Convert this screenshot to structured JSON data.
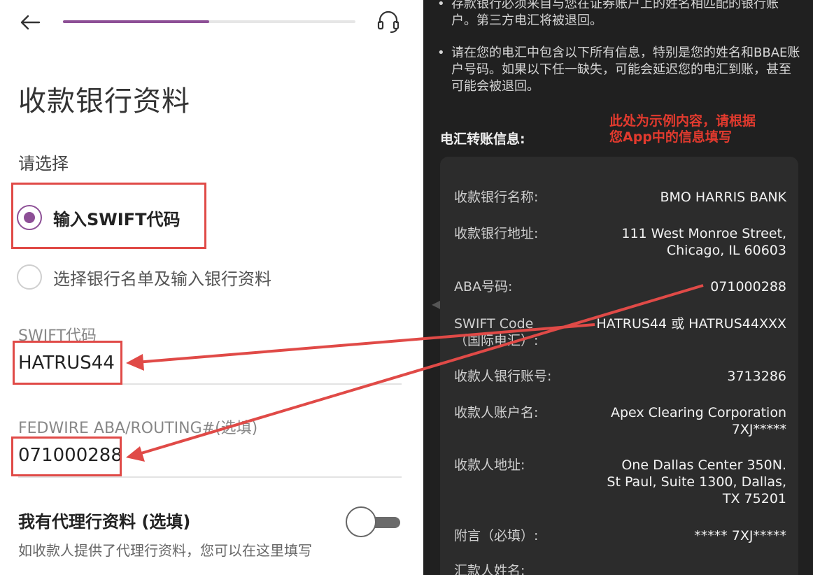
{
  "left": {
    "progress": 0.5,
    "title": "收款银行资料",
    "choose_label": "请选择",
    "options": [
      {
        "label": "输入SWIFT代码",
        "selected": true
      },
      {
        "label": "选择银行名单及输入银行资料",
        "selected": false
      }
    ],
    "swift": {
      "label": "SWIFT代码",
      "value": "HATRUS44"
    },
    "aba": {
      "label": "FEDWIRE ABA/ROUTING#(选填)",
      "value": "071000288"
    },
    "agent": {
      "title": "我有代理行资料 (选填)",
      "desc": "如收款人提供了代理行资料，您可以在这里填写",
      "toggle_on": false
    }
  },
  "right": {
    "notes": [
      "存款银行必须来自与您在证券账户上的姓名相匹配的银行账户。第三方电汇将被退回。",
      "请在您的电汇中包含以下所有信息，特别是您的姓名和BBAE账户号码。如果以下任一缺失，可能会延迟您的电汇到账，甚至可能会被退回。"
    ],
    "section_title": "电汇转账信息:",
    "annotation": "此处为示例内容，请根据您App中的信息填写",
    "rows": [
      {
        "label": "收款银行名称:",
        "value": "BMO HARRIS BANK"
      },
      {
        "label": "收款银行地址:",
        "value": "111 West Monroe Street, Chicago, IL 60603"
      },
      {
        "label": "ABA号码:",
        "value": "071000288"
      },
      {
        "label": "SWIFT Code（国际电汇）:",
        "value": "HATRUS44 或 HATRUS44XXX"
      },
      {
        "label": "收款人银行账号:",
        "value": "3713286"
      },
      {
        "label": "收款人账户名:",
        "value": "Apex Clearing Corporation 7XJ*****"
      },
      {
        "label": "收款人地址:",
        "value": "One Dallas Center 350N. St Paul, Suite 1300, Dallas, TX 75201"
      },
      {
        "label": "附言（必填）:",
        "value": "***** 7XJ*****"
      },
      {
        "label": "汇款人姓名:",
        "value": ""
      }
    ]
  },
  "colors": {
    "accent": "#8d4f96",
    "annotation_red": "#e04a47",
    "dark_bg": "#202020"
  },
  "icons": {
    "back": "arrow-left-icon",
    "support": "headset-icon",
    "bullet": "bullet-icon"
  }
}
